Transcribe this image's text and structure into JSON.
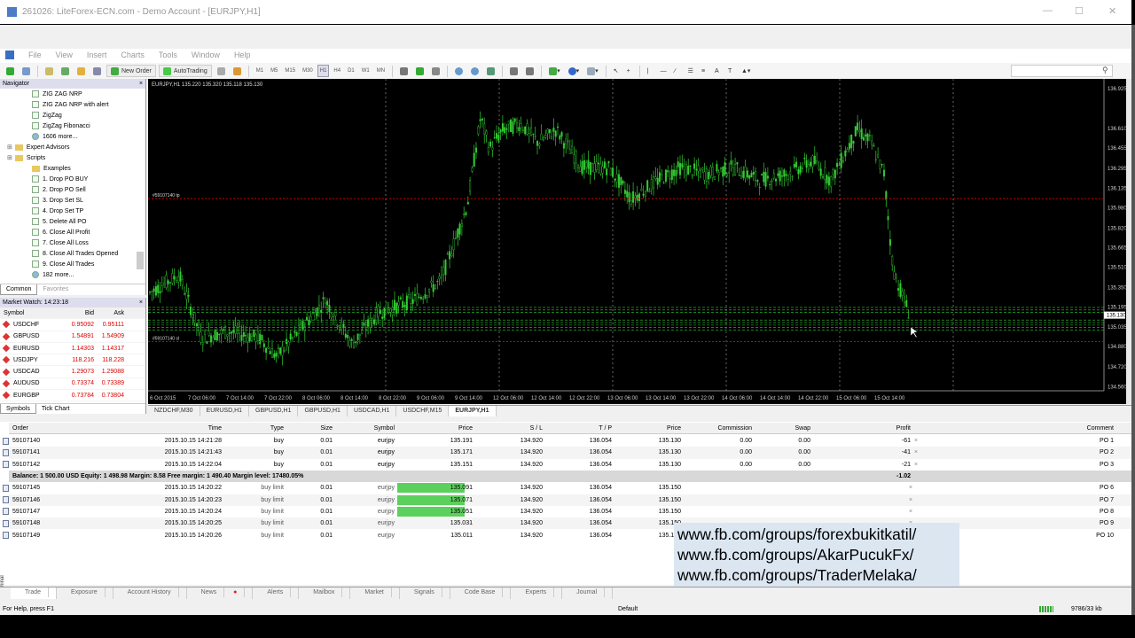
{
  "window": {
    "title": "261026: LiteForex-ECN.com - Demo Account - [EURJPY,H1]"
  },
  "menu": [
    "File",
    "View",
    "Insert",
    "Charts",
    "Tools",
    "Window",
    "Help"
  ],
  "toolbar": {
    "new_order": "New Order",
    "autotrading": "AutoTrading",
    "timeframes": [
      "M1",
      "M5",
      "M15",
      "M30",
      "H1",
      "H4",
      "D1",
      "W1",
      "MN"
    ]
  },
  "navigator": {
    "title": "Navigator",
    "items": [
      {
        "label": "ZIG ZAG NRP",
        "type": "ind",
        "level": 2
      },
      {
        "label": "ZIG ZAG NRP with alert",
        "type": "ind",
        "level": 2
      },
      {
        "label": "ZigZag",
        "type": "ind",
        "level": 2
      },
      {
        "label": "ZigZag Fibonacci",
        "type": "ind",
        "level": 2
      },
      {
        "label": "1606 more...",
        "type": "more",
        "level": 2
      },
      {
        "label": "Expert Advisors",
        "type": "folder",
        "level": 1
      },
      {
        "label": "Scripts",
        "type": "folder",
        "level": 1
      },
      {
        "label": "Examples",
        "type": "folder",
        "level": 2
      },
      {
        "label": "1. Drop PO BUY",
        "type": "ind",
        "level": 2
      },
      {
        "label": "2. Drop PO Sell",
        "type": "ind",
        "level": 2
      },
      {
        "label": "3. Drop Set SL",
        "type": "ind",
        "level": 2
      },
      {
        "label": "4. Drop Set TP",
        "type": "ind",
        "level": 2
      },
      {
        "label": "5. Delete All PO",
        "type": "ind",
        "level": 2
      },
      {
        "label": "6. Close All Profit",
        "type": "ind",
        "level": 2
      },
      {
        "label": "7. Close All Loss",
        "type": "ind",
        "level": 2
      },
      {
        "label": "8. Close All Trades Opened",
        "type": "ind",
        "level": 2
      },
      {
        "label": "9. Close All Trades",
        "type": "ind",
        "level": 2
      },
      {
        "label": "182 more...",
        "type": "more",
        "level": 2
      }
    ],
    "tabs": [
      "Common",
      "Favorites"
    ]
  },
  "market_watch": {
    "title": "Market Watch: 14:23:18",
    "headers": [
      "Symbol",
      "Bid",
      "Ask"
    ],
    "rows": [
      {
        "symbol": "USDCHF",
        "bid": "0.95092",
        "ask": "0.95111"
      },
      {
        "symbol": "GBPUSD",
        "bid": "1.54891",
        "ask": "1.54909"
      },
      {
        "symbol": "EURUSD",
        "bid": "1.14303",
        "ask": "1.14317"
      },
      {
        "symbol": "USDJPY",
        "bid": "118.216",
        "ask": "118.228"
      },
      {
        "symbol": "USDCAD",
        "bid": "1.29073",
        "ask": "1.29088"
      },
      {
        "symbol": "AUDUSD",
        "bid": "0.73374",
        "ask": "0.73389"
      },
      {
        "symbol": "EURGBP",
        "bid": "0.73784",
        "ask": "0.73804"
      }
    ],
    "tabs": [
      "Symbols",
      "Tick Chart"
    ]
  },
  "chart": {
    "header": "EURJPY,H1  135.220 135.320 135.118 135.130",
    "price_labels": [
      "136.925",
      "136.610",
      "136.455",
      "136.295",
      "136.135",
      "135.980",
      "135.820",
      "135.665",
      "135.510",
      "135.350",
      "135.195",
      "135.035",
      "134.880",
      "134.720",
      "134.560"
    ],
    "time_labels": [
      "6 Oct 2015",
      "7 Oct 06:00",
      "7 Oct 14:00",
      "7 Oct 22:00",
      "8 Oct 06:00",
      "8 Oct 14:00",
      "8 Oct 22:00",
      "9 Oct 06:00",
      "9 Oct 14:00",
      "12 Oct 06:00",
      "12 Oct 14:00",
      "12 Oct 22:00",
      "13 Oct 06:00",
      "13 Oct 14:00",
      "13 Oct 22:00",
      "14 Oct 06:00",
      "14 Oct 14:00",
      "14 Oct 22:00",
      "15 Oct 06:00",
      "15 Oct 14:00"
    ],
    "order_label_top": "#59107140 tp",
    "order_label_sl": "#59107140 sl",
    "bid_tag": "135.130"
  },
  "chart_tabs": [
    "NZDCHF,M30",
    "EURUSD,H1",
    "GBPUSD,H1",
    "GBPUSD,H1",
    "USDCAD,H1",
    "USDCHF,M15",
    "EURJPY,H1"
  ],
  "terminal": {
    "headers": [
      "Order",
      "Time",
      "Type",
      "Size",
      "Symbol",
      "Price",
      "S / L",
      "T / P",
      "Price",
      "Commission",
      "Swap",
      "Profit",
      "Comment"
    ],
    "open": [
      {
        "order": "59107140",
        "time": "2015.10.15 14:21:28",
        "type": "buy",
        "size": "0.01",
        "symbol": "eurjpy",
        "price": "135.191",
        "sl": "134.920",
        "tp": "136.054",
        "cur": "135.130",
        "comm": "0.00",
        "swap": "0.00",
        "profit": "-61",
        "comment": "PO 1"
      },
      {
        "order": "59107141",
        "time": "2015.10.15 14:21:43",
        "type": "buy",
        "size": "0.01",
        "symbol": "eurjpy",
        "price": "135.171",
        "sl": "134.920",
        "tp": "136.054",
        "cur": "135.130",
        "comm": "0.00",
        "swap": "0.00",
        "profit": "-41",
        "comment": "PO 2"
      },
      {
        "order": "59107142",
        "time": "2015.10.15 14:22:04",
        "type": "buy",
        "size": "0.01",
        "symbol": "eurjpy",
        "price": "135.151",
        "sl": "134.920",
        "tp": "136.054",
        "cur": "135.130",
        "comm": "0.00",
        "swap": "0.00",
        "profit": "-21",
        "comment": "PO 3"
      }
    ],
    "balance": "Balance: 1 500.00 USD  Equity: 1 498.98  Margin: 8.58  Free margin: 1 490.40  Margin level: 17480.05%",
    "balance_profit": "-1.02",
    "pending": [
      {
        "order": "59107145",
        "time": "2015.10.15 14:20:22",
        "type": "buy limit",
        "size": "0.01",
        "symbol": "eurjpy",
        "price": "135.091",
        "sl": "134.920",
        "tp": "136.054",
        "cur": "135.150",
        "comment": "PO 6",
        "hl": true
      },
      {
        "order": "59107146",
        "time": "2015.10.15 14:20:23",
        "type": "buy limit",
        "size": "0.01",
        "symbol": "eurjpy",
        "price": "135.071",
        "sl": "134.920",
        "tp": "136.054",
        "cur": "135.150",
        "comment": "PO 7",
        "hl": true
      },
      {
        "order": "59107147",
        "time": "2015.10.15 14:20:24",
        "type": "buy limit",
        "size": "0.01",
        "symbol": "eurjpy",
        "price": "135.051",
        "sl": "134.920",
        "tp": "136.054",
        "cur": "135.150",
        "comment": "PO 8",
        "hl": true
      },
      {
        "order": "59107148",
        "time": "2015.10.15 14:20:25",
        "type": "buy limit",
        "size": "0.01",
        "symbol": "eurjpy",
        "price": "135.031",
        "sl": "134.920",
        "tp": "136.054",
        "cur": "135.150",
        "comment": "PO 9",
        "hl": false
      },
      {
        "order": "59107149",
        "time": "2015.10.15 14:20:26",
        "type": "buy limit",
        "size": "0.01",
        "symbol": "eurjpy",
        "price": "135.011",
        "sl": "134.920",
        "tp": "136.054",
        "cur": "135.150",
        "comment": "PO 10",
        "hl": false
      }
    ],
    "tabs": [
      "Trade",
      "Exposure",
      "Account History",
      "News",
      "Alerts",
      "Mailbox",
      "Market",
      "Signals",
      "Code Base",
      "Experts",
      "Journal"
    ],
    "side_label": "Terminal"
  },
  "overlay_links": [
    "www.fb.com/groups/forexbukitkatil/",
    "www.fb.com/groups/AkarPucukFx/",
    "www.fb.com/groups/TraderMelaka/"
  ],
  "status": {
    "help": "For Help, press F1",
    "profile": "Default",
    "traffic": "9786/33 kb"
  },
  "colors": {
    "candle": "#33cc33",
    "sl_line": "#cc0000",
    "order_line": "#33cc33",
    "pending_hl": "#5cd05c"
  }
}
